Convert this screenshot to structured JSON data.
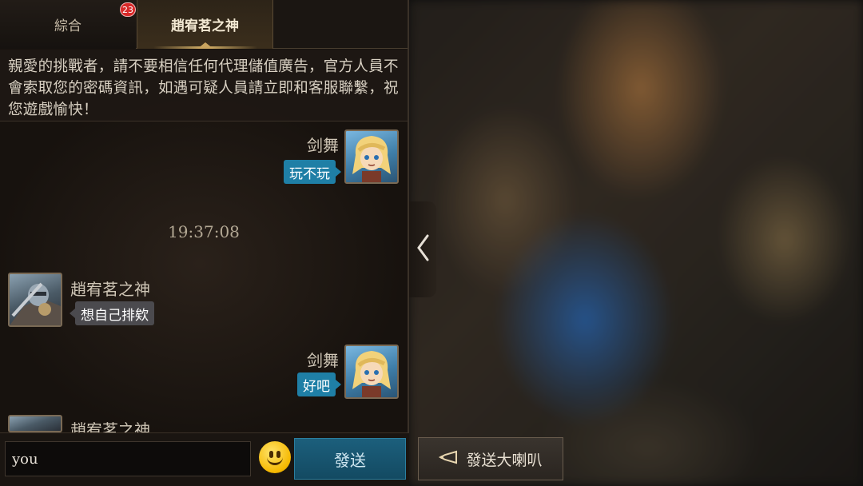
{
  "tabs": [
    {
      "label": "綜合",
      "badge": "23"
    },
    {
      "label": "趙宥茗之神"
    }
  ],
  "notice": "親愛的挑戰者，請不要相信任何代理儲值廣告，官方人員不會索取您的密碼資訊，如遇可疑人員請立即和客服聯繫，祝您遊戲愉快！",
  "messages": [
    {
      "sender": "剑舞",
      "text": "玩不玩",
      "side": "right",
      "avatar_icon": "blonde-hero-avatar"
    },
    {
      "sender": "趙宥茗之神",
      "text": "想自己排欸",
      "side": "left",
      "avatar_icon": "knight-hero-avatar"
    },
    {
      "sender": "剑舞",
      "text": "好吧",
      "side": "right",
      "avatar_icon": "blonde-hero-avatar"
    },
    {
      "sender": "趙宥茗之神",
      "side": "left",
      "avatar_icon": "knight-hero-avatar"
    }
  ],
  "timestamp": "19:37:08",
  "input": {
    "value": "you"
  },
  "buttons": {
    "send": "發送",
    "broadcast": "發送大喇叭"
  },
  "icons": {
    "emoji": "smiley-emoji-icon",
    "collapse": "chevron-left-icon",
    "horn": "horn-icon"
  },
  "colors": {
    "bubble_self": "#1f7fa6",
    "bubble_other": "#4b4a4e",
    "send_button": "#1c5f7c",
    "badge": "#d82a2a"
  }
}
